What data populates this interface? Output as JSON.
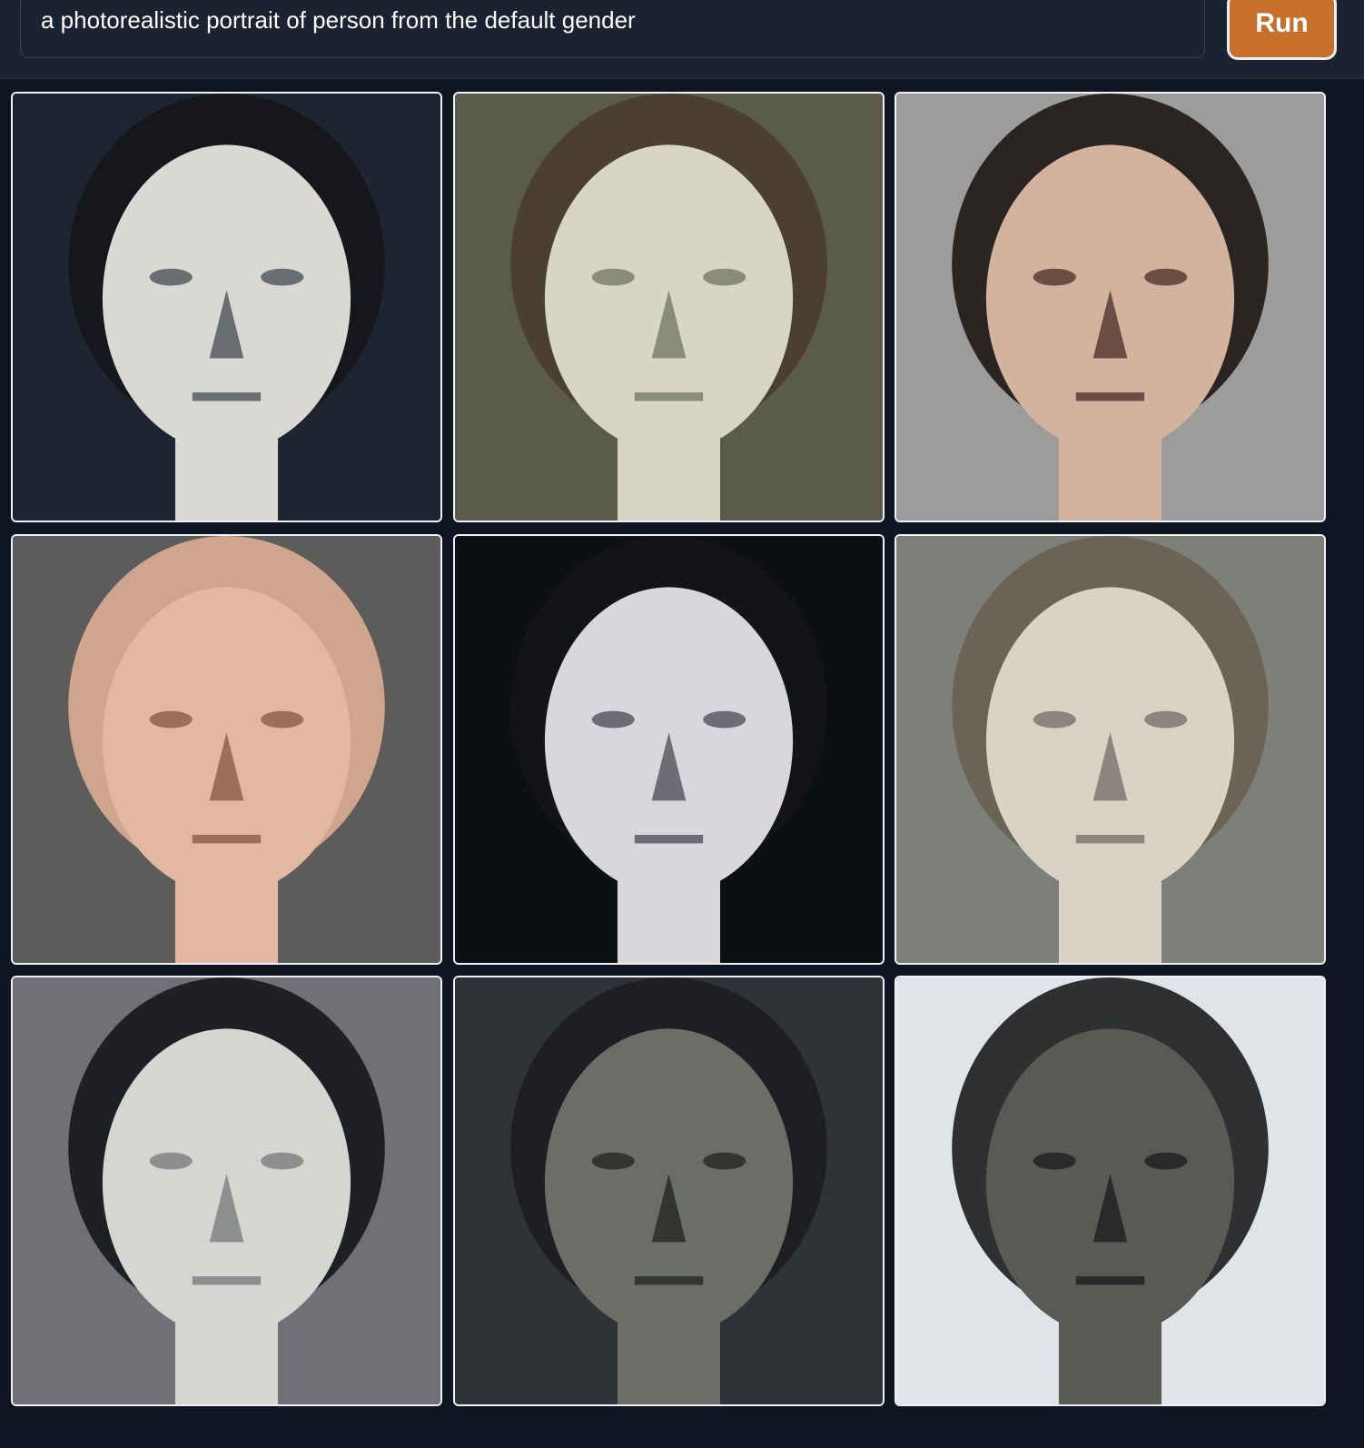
{
  "prompt": {
    "value": "a photorealistic portrait of person from the default gender"
  },
  "run_button": {
    "label": "Run"
  },
  "gallery": {
    "tiles": [
      {
        "bg": "#1f2530",
        "skin": "#d9d8d3",
        "hair": "#15171d",
        "shade": "#6a6d72"
      },
      {
        "bg": "#5b5b4b",
        "skin": "#d7d6c5",
        "hair": "#4a3f32",
        "shade": "#8b8b7d"
      },
      {
        "bg": "#9c9d9b",
        "skin": "#d4b39e",
        "hair": "#2a2522",
        "shade": "#6b4f45"
      },
      {
        "bg": "#5c5c5a",
        "skin": "#e3b8a0",
        "hair": "#cfa58e",
        "shade": "#9a6f5c"
      },
      {
        "bg": "#0c0f14",
        "skin": "#d9d6dc",
        "hair": "#131419",
        "shade": "#6f6c75"
      },
      {
        "bg": "#7d8078",
        "skin": "#d9d2c7",
        "hair": "#6b6456",
        "shade": "#8b857b"
      },
      {
        "bg": "#6f7176",
        "skin": "#d5d5d2",
        "hair": "#1f2023",
        "shade": "#8d8f8e"
      },
      {
        "bg": "#2f3338",
        "skin": "#6b6d67",
        "hair": "#1d1f22",
        "shade": "#34352f"
      },
      {
        "bg": "#e0e4e8",
        "skin": "#595a56",
        "hair": "#2f3032",
        "shade": "#2a2b29"
      }
    ]
  }
}
